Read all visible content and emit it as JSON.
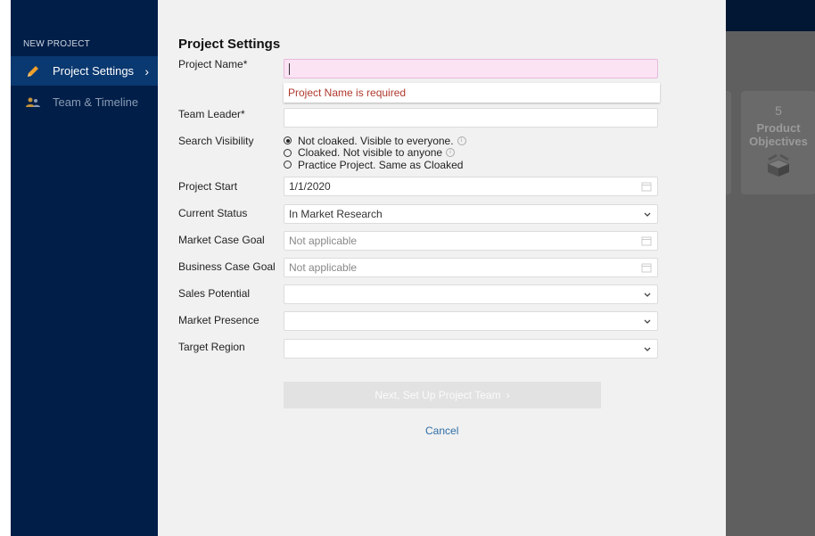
{
  "background": {
    "card_number": "5",
    "card_title": "Product Objectives"
  },
  "sidebar": {
    "heading": "NEW PROJECT",
    "items": [
      {
        "label": "Project Settings",
        "icon": "pencil-icon",
        "active": true
      },
      {
        "label": "Team & Timeline",
        "icon": "team-icon",
        "active": false
      }
    ],
    "colors": {
      "bg": "#011e48",
      "active_bg": "#0a3870",
      "pencil": "#f0a12a"
    }
  },
  "form": {
    "title": "Project Settings",
    "project_name": {
      "label": "Project Name*",
      "value": "",
      "error": "Project Name is required"
    },
    "team_leader": {
      "label": "Team Leader*",
      "value": ""
    },
    "search_visibility": {
      "label": "Search Visibility",
      "options": [
        {
          "label": "Not cloaked. Visible to everyone.",
          "selected": true,
          "info": true
        },
        {
          "label": "Cloaked. Not visible to anyone",
          "selected": false,
          "info": true
        },
        {
          "label": "Practice Project. Same as Cloaked",
          "selected": false,
          "info": false
        }
      ]
    },
    "project_start": {
      "label": "Project Start",
      "value": "1/1/2020"
    },
    "current_status": {
      "label": "Current Status",
      "value": "In Market Research"
    },
    "market_case_goal": {
      "label": "Market Case Goal",
      "placeholder": "Not applicable"
    },
    "business_case_goal": {
      "label": "Business Case Goal",
      "placeholder": "Not applicable"
    },
    "sales_potential": {
      "label": "Sales Potential",
      "value": ""
    },
    "market_presence": {
      "label": "Market Presence",
      "value": ""
    },
    "target_region": {
      "label": "Target Region",
      "value": ""
    },
    "next_button": "Next, Set Up Project Team",
    "cancel_link": "Cancel"
  }
}
